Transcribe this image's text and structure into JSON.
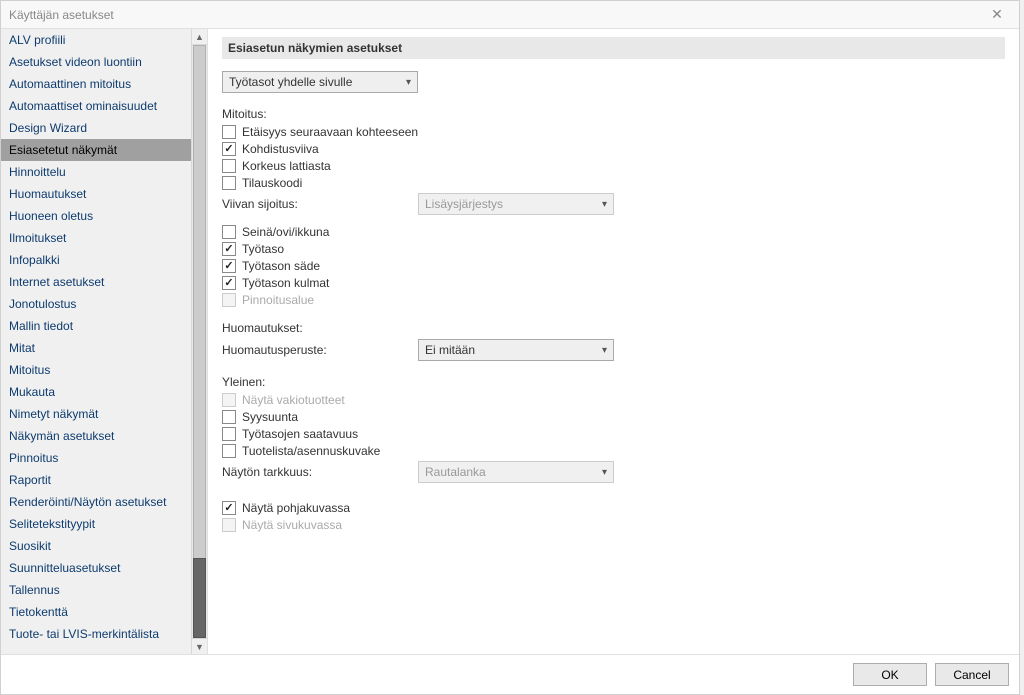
{
  "window": {
    "title": "Käyttäjän asetukset"
  },
  "sidebar": {
    "items": [
      {
        "label": "ALV profiili"
      },
      {
        "label": "Asetukset videon luontiin"
      },
      {
        "label": "Automaattinen mitoitus"
      },
      {
        "label": "Automaattiset ominaisuudet"
      },
      {
        "label": "Design Wizard"
      },
      {
        "label": "Esiasetetut näkymät",
        "selected": true
      },
      {
        "label": "Hinnoittelu"
      },
      {
        "label": "Huomautukset"
      },
      {
        "label": "Huoneen oletus"
      },
      {
        "label": "Ilmoitukset"
      },
      {
        "label": "Infopalkki"
      },
      {
        "label": "Internet asetukset"
      },
      {
        "label": "Jonotulostus"
      },
      {
        "label": "Mallin tiedot"
      },
      {
        "label": "Mitat"
      },
      {
        "label": "Mitoitus"
      },
      {
        "label": "Mukauta"
      },
      {
        "label": "Nimetyt näkymät"
      },
      {
        "label": "Näkymän asetukset"
      },
      {
        "label": "Pinnoitus"
      },
      {
        "label": "Raportit"
      },
      {
        "label": "Renderöinti/Näytön asetukset"
      },
      {
        "label": "Selitetekstityypit"
      },
      {
        "label": "Suosikit"
      },
      {
        "label": "Suunnitteluasetukset"
      },
      {
        "label": "Tallennus"
      },
      {
        "label": "Tietokenttä"
      },
      {
        "label": "Tuote- tai LVIS-merkintälista"
      }
    ]
  },
  "main": {
    "header": "Esiasetun näkymien asetukset",
    "view_select": "Työtasot yhdelle sivulle",
    "mitoitus_label": "Mitoitus:",
    "mitoitus": {
      "etaisyys": "Etäisyys seuraavaan kohteeseen",
      "kohdistusviiva": "Kohdistusviiva",
      "korkeus": "Korkeus lattiasta",
      "tilauskoodi": "Tilauskoodi",
      "viivan_label": "Viivan sijoitus:",
      "viivan_value": "Lisäysjärjestys",
      "seina": "Seinä/ovi/ikkuna",
      "tyotaso": "Työtaso",
      "sade": "Työtason säde",
      "kulmat": "Työtason kulmat",
      "pinnoitusalue": "Pinnoitusalue"
    },
    "huom_label": "Huomautukset:",
    "huom_peruste_label": "Huomautusperuste:",
    "huom_peruste_value": "Ei mitään",
    "yleinen_label": "Yleinen:",
    "yleinen": {
      "nayta_vakio": "Näytä vakiotuotteet",
      "syysuunta": "Syysuunta",
      "saatavuus": "Työtasojen saatavuus",
      "tuotelista": "Tuotelista/asennuskuvake",
      "tarkkuus_label": "Näytön tarkkuus:",
      "tarkkuus_value": "Rautalanka"
    },
    "nayta_pohja": "Näytä pohjakuvassa",
    "nayta_sivu": "Näytä sivukuvassa"
  },
  "footer": {
    "ok": "OK",
    "cancel": "Cancel"
  }
}
